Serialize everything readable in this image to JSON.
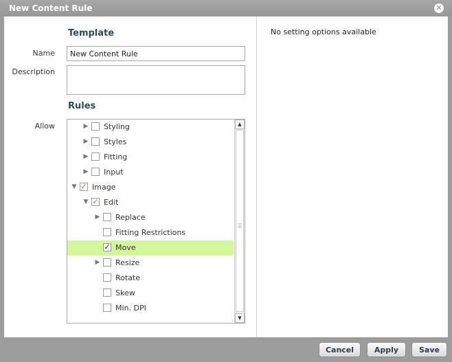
{
  "dialog": {
    "title": "New Content Rule",
    "close_icon": "close-icon"
  },
  "template": {
    "heading": "Template",
    "name_label": "Name",
    "name_value": "New Content Rule",
    "description_label": "Description",
    "description_value": ""
  },
  "rules": {
    "heading": "Rules",
    "allow_label": "Allow",
    "tree": [
      {
        "label": "Styling",
        "depth": 1,
        "toggle": "collapsed",
        "checked": "none"
      },
      {
        "label": "Styles",
        "depth": 1,
        "toggle": "collapsed",
        "checked": "none"
      },
      {
        "label": "Fitting",
        "depth": 1,
        "toggle": "collapsed",
        "checked": "none"
      },
      {
        "label": "Input",
        "depth": 1,
        "toggle": "collapsed",
        "checked": "none"
      },
      {
        "label": "Image",
        "depth": 0,
        "toggle": "expanded",
        "checked": "partial"
      },
      {
        "label": "Edit",
        "depth": 1,
        "toggle": "expanded",
        "checked": "partial"
      },
      {
        "label": "Replace",
        "depth": 2,
        "toggle": "collapsed",
        "checked": "none"
      },
      {
        "label": "Fitting Restrictions",
        "depth": 2,
        "toggle": "none",
        "checked": "none"
      },
      {
        "label": "Move",
        "depth": 2,
        "toggle": "none",
        "checked": "full",
        "selected": true
      },
      {
        "label": "Resize",
        "depth": 2,
        "toggle": "collapsed",
        "checked": "none"
      },
      {
        "label": "Rotate",
        "depth": 2,
        "toggle": "none",
        "checked": "none"
      },
      {
        "label": "Skew",
        "depth": 2,
        "toggle": "none",
        "checked": "none"
      },
      {
        "label": "Min. DPI",
        "depth": 2,
        "toggle": "none",
        "checked": "none"
      }
    ]
  },
  "settings": {
    "empty_text": "No setting options available"
  },
  "buttons": {
    "cancel": "Cancel",
    "apply": "Apply",
    "save": "Save"
  },
  "colors": {
    "selected_row": "#d4f79c",
    "partial_check": "#e25b2a",
    "heading": "#2b4b5a"
  }
}
